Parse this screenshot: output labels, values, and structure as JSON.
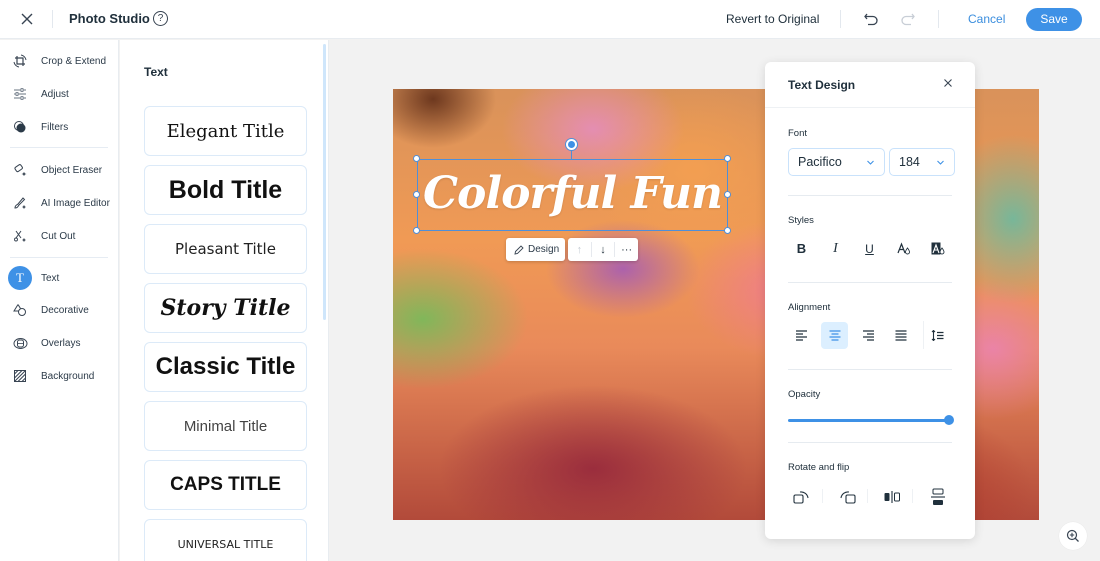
{
  "header": {
    "title": "Photo Studio",
    "help_icon": "question-circle-icon",
    "revert_label": "Revert to Original",
    "cancel_label": "Cancel",
    "save_label": "Save"
  },
  "sidebar": {
    "items": [
      {
        "label": "Crop & Extend",
        "icon": "crop-rotate-icon"
      },
      {
        "label": "Adjust",
        "icon": "sliders-icon"
      },
      {
        "label": "Filters",
        "icon": "filters-icon"
      },
      {
        "label": "Object Eraser",
        "icon": "eraser-sparkle-icon"
      },
      {
        "label": "AI Image Editor",
        "icon": "brush-sparkle-icon"
      },
      {
        "label": "Cut Out",
        "icon": "scissors-sparkle-icon"
      },
      {
        "label": "Text",
        "icon": "text-icon",
        "active": true,
        "glyph": "T"
      },
      {
        "label": "Decorative",
        "icon": "shapes-icon"
      },
      {
        "label": "Overlays",
        "icon": "overlays-icon"
      },
      {
        "label": "Background",
        "icon": "background-pattern-icon"
      }
    ]
  },
  "text_panel": {
    "title": "Text",
    "presets": [
      "Elegant Title",
      "Bold Title",
      "Pleasant Title",
      "Story Title",
      "Classic Title",
      "Minimal Title",
      "CAPS TITLE",
      "UNIVERSAL TITLE"
    ]
  },
  "canvas": {
    "overlay_text": "Colorful Fun",
    "overlay_text_color": "#ffffff",
    "floating_toolbar": {
      "design_label": "Design",
      "move_up": "↑",
      "move_down": "↓",
      "more": "···"
    }
  },
  "text_design": {
    "title": "Text Design",
    "font_label": "Font",
    "font_family": "Pacifico",
    "font_size": "184",
    "styles_label": "Styles",
    "styles": [
      {
        "name": "bold",
        "glyph": "B"
      },
      {
        "name": "italic",
        "glyph": "I"
      },
      {
        "name": "underline",
        "glyph": "U"
      },
      {
        "name": "text-color",
        "glyph": "A"
      },
      {
        "name": "highlight-color",
        "glyph": "A"
      }
    ],
    "alignment_label": "Alignment",
    "alignment_selected": "center",
    "opacity_label": "Opacity",
    "opacity_value": 100,
    "rotate_label": "Rotate and flip"
  },
  "colors": {
    "accent": "#3e91e6",
    "active_bg": "#dcefff",
    "text_dark": "#20303c"
  }
}
